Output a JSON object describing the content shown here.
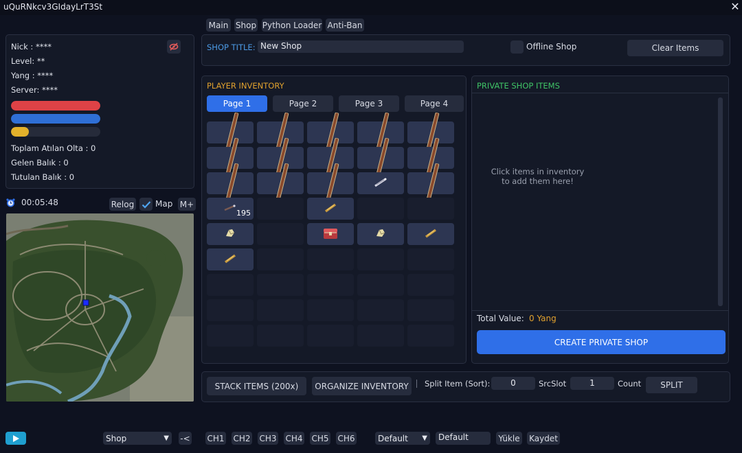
{
  "window": {
    "title": "uQuRNkcv3GIdayLrT3St",
    "close": "✕"
  },
  "tabs": [
    "Main",
    "Shop",
    "Python Loader",
    "Anti-Ban"
  ],
  "player": {
    "nick": "Nick : ****",
    "level": "Level: **",
    "yang": "Yang : ****",
    "server": "Server: ****",
    "bars": {
      "hp": 1.0,
      "mp": 1.0,
      "exp": 0.2
    },
    "bar_colors": {
      "hp": "#de4246",
      "mp": "#2f6fd6",
      "exp": "#e2b12b"
    },
    "stats": [
      "Toplam Atılan Olta : 0",
      "Gelen Balık : 0",
      "Tutulan Balık : 0"
    ]
  },
  "timer": {
    "value": "00:05:48",
    "relog": "Relog",
    "map": "Map",
    "mplus": "M+",
    "map_checked": true
  },
  "shop_header": {
    "title_label": "SHOP TITLE:",
    "title_value": "New Shop",
    "offline_label": "Offline Shop",
    "clear_button": "Clear Items"
  },
  "inventory": {
    "title": "PLAYER INVENTORY",
    "pages": [
      "Page 1",
      "Page 2",
      "Page 3",
      "Page 4"
    ],
    "active_page": 0,
    "rows": [
      [
        "sword",
        "sword",
        "sword",
        "sword",
        "sword"
      ],
      [
        "sword",
        "sword",
        "sword",
        "sword",
        "sword"
      ],
      [
        "sword",
        "sword",
        "sword",
        "scroll",
        "sword"
      ],
      [
        "rod",
        "empty",
        "rune",
        "empty",
        "empty"
      ],
      [
        "ore",
        "empty",
        "chest",
        "ore",
        "rune"
      ],
      [
        "rune",
        "empty",
        "empty",
        "empty",
        "empty"
      ],
      [
        "empty",
        "empty",
        "empty",
        "empty",
        "empty"
      ],
      [
        "empty",
        "empty",
        "empty",
        "empty",
        "empty"
      ],
      [
        "empty",
        "empty",
        "empty",
        "empty",
        "empty"
      ]
    ],
    "quantity_text": "195"
  },
  "private_shop": {
    "title": "PRIVATE SHOP ITEMS",
    "hint_line1": "Click items in inventory",
    "hint_line2": "to add them here!",
    "total_label": "Total Value:",
    "total_value": "0 Yang",
    "create_button": "CREATE PRIVATE SHOP"
  },
  "actions": {
    "stack": "STACK ITEMS (200x)",
    "organize": "ORGANIZE INVENTORY",
    "split_label": "Split Item (Sort):",
    "split_value": "0",
    "srcslot_label": "SrcSlot",
    "srcslot_value": "1",
    "count_label": "Count",
    "split_button": "SPLIT"
  },
  "bottom": {
    "mode": "Shop",
    "mode_arrow": "▼",
    "back": "-<",
    "channels": [
      "CH1",
      "CH2",
      "CH3",
      "CH4",
      "CH5",
      "CH6"
    ],
    "profile": "Default",
    "profile_arrow": "▼",
    "profile_name": "Default",
    "load": "Yükle",
    "save": "Kaydet"
  },
  "colors": {
    "accent_blue": "#2f6fe8",
    "gold": "#e0a12e",
    "green": "#3fc466",
    "title_blue": "#4c9ae6"
  }
}
